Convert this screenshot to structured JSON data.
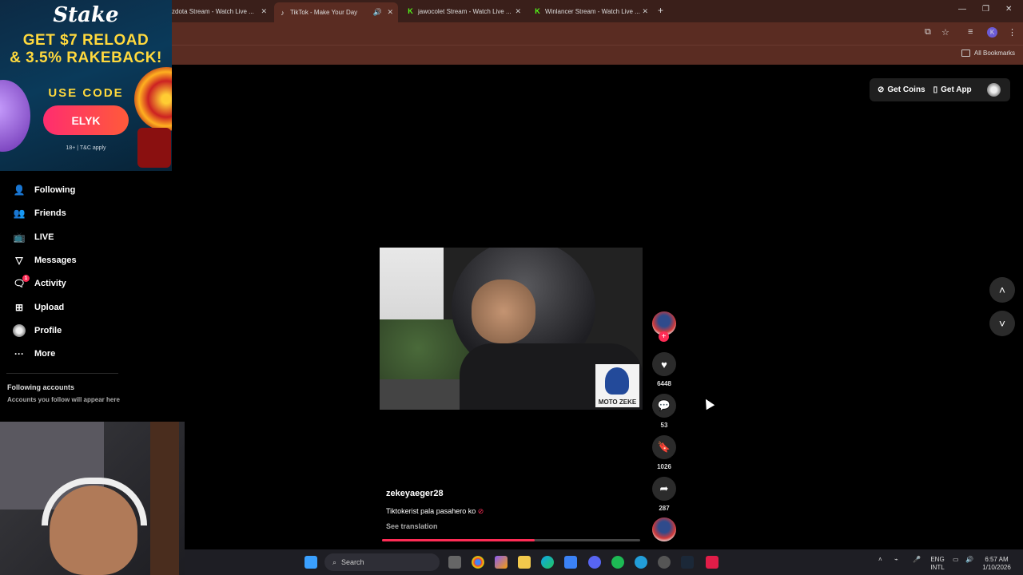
{
  "browser": {
    "tabs": [
      {
        "title": "kzdota Stream - Watch Live ...",
        "active": false
      },
      {
        "title": "TikTok - Make Your Day",
        "active": true
      },
      {
        "title": "jawocolet Stream - Watch Live ...",
        "active": false
      },
      {
        "title": "Winlancer Stream - Watch Live ...",
        "active": false
      }
    ],
    "new_tab": "+",
    "bookmarks_label": "All Bookmarks"
  },
  "ad": {
    "brand": "Stake",
    "line1": "GET $7 RELOAD",
    "line2": "& 3.5% RAKEBACK!",
    "use_code": "USE CODE",
    "code": "ELYK",
    "terms": "18+ | T&C apply"
  },
  "sidebar": {
    "items": [
      {
        "label": "Following",
        "icon": "person-icon"
      },
      {
        "label": "Friends",
        "icon": "friends-icon"
      },
      {
        "label": "LIVE",
        "icon": "live-icon"
      },
      {
        "label": "Messages",
        "icon": "messages-icon"
      },
      {
        "label": "Activity",
        "icon": "activity-icon",
        "badge": "1"
      },
      {
        "label": "Upload",
        "icon": "upload-icon"
      },
      {
        "label": "Profile",
        "icon": "profile-icon"
      },
      {
        "label": "More",
        "icon": "more-icon"
      }
    ],
    "following_title": "Following accounts",
    "following_sub": "Accounts you follow will appear here"
  },
  "header": {
    "get_coins": "Get Coins",
    "get_app": "Get App"
  },
  "video": {
    "overlay_label": "MOTO ZEKE",
    "author": "zekeyaeger28",
    "caption": "Tiktokerist pala pasahero ko",
    "see_translation": "See translation",
    "progress": 0.59
  },
  "actions": {
    "likes": "6448",
    "comments": "53",
    "saves": "1026",
    "shares": "287"
  },
  "taskbar": {
    "search": "Search",
    "lang_top": "ENG",
    "lang_bottom": "INTL",
    "time": "6:57 AM",
    "date": "1/10/2026"
  },
  "colors": {
    "accent": "#fe2c55",
    "browser_tab_bg": "#3a1f1a",
    "browser_toolbar": "#5a2c22",
    "ad_text": "#ffd93d"
  }
}
